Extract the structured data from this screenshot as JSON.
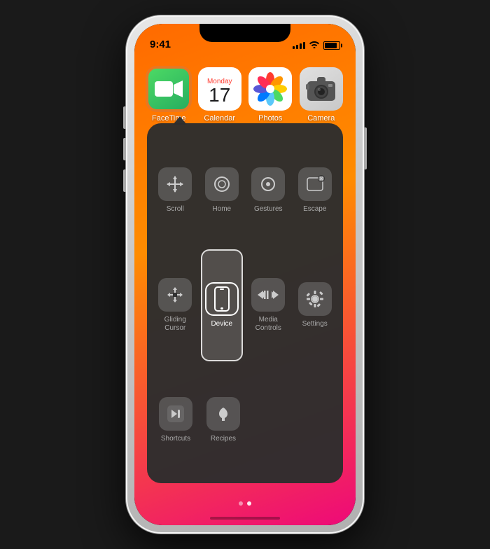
{
  "phone": {
    "status_bar": {
      "time": "9:41",
      "signal_bars": [
        4,
        6,
        8,
        10,
        12
      ],
      "battery_percent": 85
    },
    "app_grid": {
      "apps": [
        {
          "id": "facetime",
          "label": "FaceTime",
          "highlighted": true
        },
        {
          "id": "calendar",
          "label": "Calendar",
          "month": "Monday",
          "day": "17"
        },
        {
          "id": "photos",
          "label": "Photos"
        },
        {
          "id": "camera",
          "label": "Camera"
        }
      ]
    },
    "assistive_menu": {
      "rows": [
        [
          {
            "id": "scroll",
            "label": "Scroll",
            "icon": "scroll"
          },
          {
            "id": "home",
            "label": "Home",
            "icon": "home"
          },
          {
            "id": "gestures",
            "label": "Gestures",
            "icon": "gestures"
          },
          {
            "id": "escape",
            "label": "Escape",
            "icon": "escape"
          }
        ],
        [
          {
            "id": "gliding-cursor",
            "label": "Gliding\nCursor",
            "icon": "gliding"
          },
          {
            "id": "device",
            "label": "Device",
            "icon": "device",
            "highlighted": true
          },
          {
            "id": "media-controls",
            "label": "Media\nControls",
            "icon": "media"
          },
          {
            "id": "settings",
            "label": "Settings",
            "icon": "settings"
          }
        ],
        [
          {
            "id": "shortcuts",
            "label": "Shortcuts",
            "icon": "shortcuts"
          },
          {
            "id": "recipes",
            "label": "Recipes",
            "icon": "recipes"
          }
        ]
      ],
      "page_dots": [
        {
          "active": false
        },
        {
          "active": true
        }
      ]
    }
  }
}
